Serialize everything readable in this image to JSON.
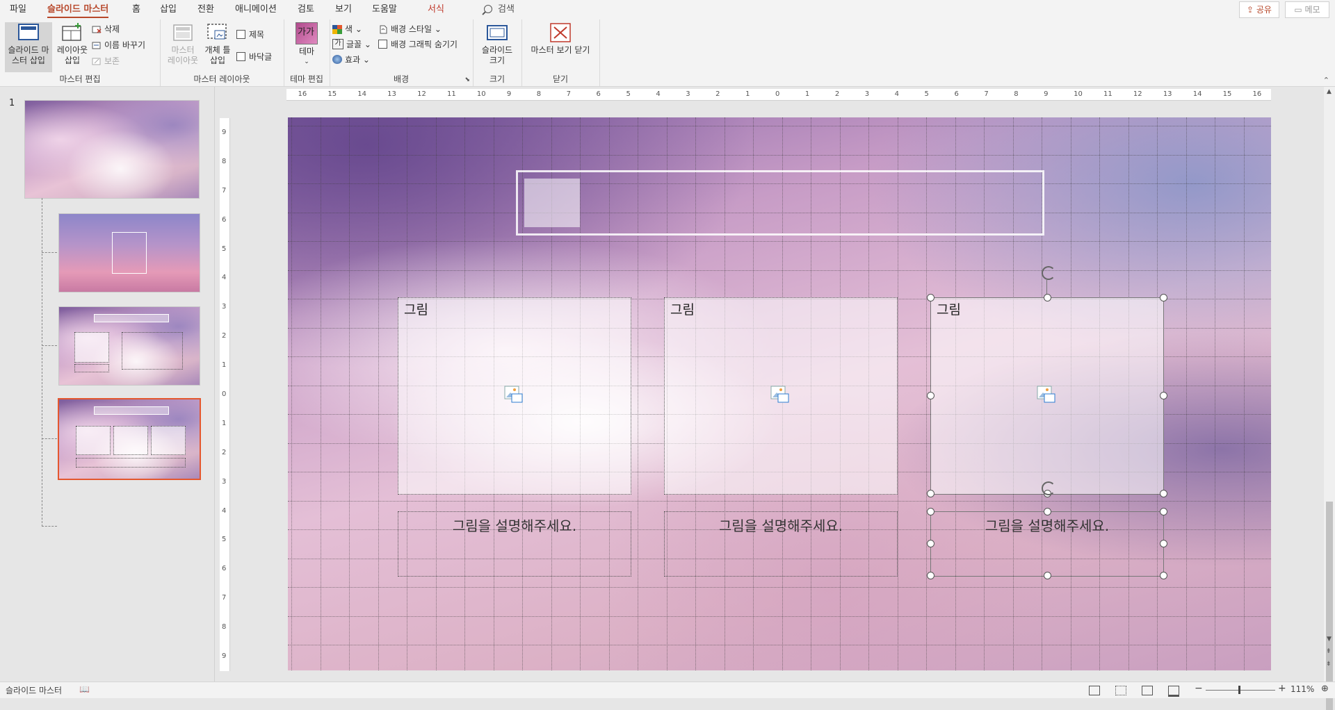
{
  "tabs": [
    {
      "label": "파일",
      "state": "normal"
    },
    {
      "label": "슬라이드 마스터",
      "state": "active"
    },
    {
      "label": "홈",
      "state": "normal"
    },
    {
      "label": "삽입",
      "state": "normal"
    },
    {
      "label": "전환",
      "state": "normal"
    },
    {
      "label": "애니메이션",
      "state": "normal"
    },
    {
      "label": "검토",
      "state": "normal"
    },
    {
      "label": "보기",
      "state": "normal"
    },
    {
      "label": "도움말",
      "state": "normal"
    },
    {
      "label": "서식",
      "state": "accent"
    }
  ],
  "search": {
    "label": "검색"
  },
  "share": {
    "label": "공유"
  },
  "memo": {
    "label": "메모"
  },
  "ribbon": {
    "master_edit": {
      "insert_master": "슬라이드 마스터 삽입",
      "insert_layout": "레이아웃 삽입",
      "delete": "삭제",
      "rename": "이름 바꾸기",
      "preserve": "보존",
      "group_label": "마스터 편집"
    },
    "master_layout": {
      "master_layout": "마스터 레이아웃",
      "insert_placeholder": "개체 틀 삽입",
      "title_chk": "제목",
      "footer_chk": "바닥글",
      "group_label": "마스터 레이아웃"
    },
    "theme_edit": {
      "theme": "테마",
      "theme_glyph": "가가",
      "group_label": "테마 편집"
    },
    "background": {
      "colors": "색",
      "fonts": "글꼴",
      "effects": "효과",
      "bg_styles": "배경 스타일",
      "hide_bg": "배경 그래픽 숨기기",
      "group_label": "배경"
    },
    "size": {
      "slide_size": "슬라이드 크기",
      "group_label": "크기"
    },
    "close": {
      "close_master": "마스터 보기 닫기",
      "group_label": "닫기"
    }
  },
  "thumbnails": {
    "slide_number": "1"
  },
  "ruler_h": [
    "16",
    "15",
    "14",
    "13",
    "12",
    "11",
    "10",
    "9",
    "8",
    "7",
    "6",
    "5",
    "4",
    "3",
    "2",
    "1",
    "0",
    "1",
    "2",
    "3",
    "4",
    "5",
    "6",
    "7",
    "8",
    "9",
    "10",
    "11",
    "12",
    "13",
    "14",
    "15",
    "16"
  ],
  "ruler_v": [
    "9",
    "8",
    "7",
    "6",
    "5",
    "4",
    "3",
    "2",
    "1",
    "0",
    "1",
    "2",
    "3",
    "4",
    "5",
    "6",
    "7",
    "8",
    "9"
  ],
  "slide": {
    "pictures": [
      {
        "label": "그림",
        "caption": "그림을 설명해주세요."
      },
      {
        "label": "그림",
        "caption": "그림을 설명해주세요."
      },
      {
        "label": "그림",
        "caption": "그림을 설명해주세요."
      }
    ]
  },
  "status": {
    "mode": "슬라이드 마스터",
    "zoom": "111%"
  },
  "colors": {
    "accent": "#b7472a",
    "selection": "#e4572e"
  }
}
